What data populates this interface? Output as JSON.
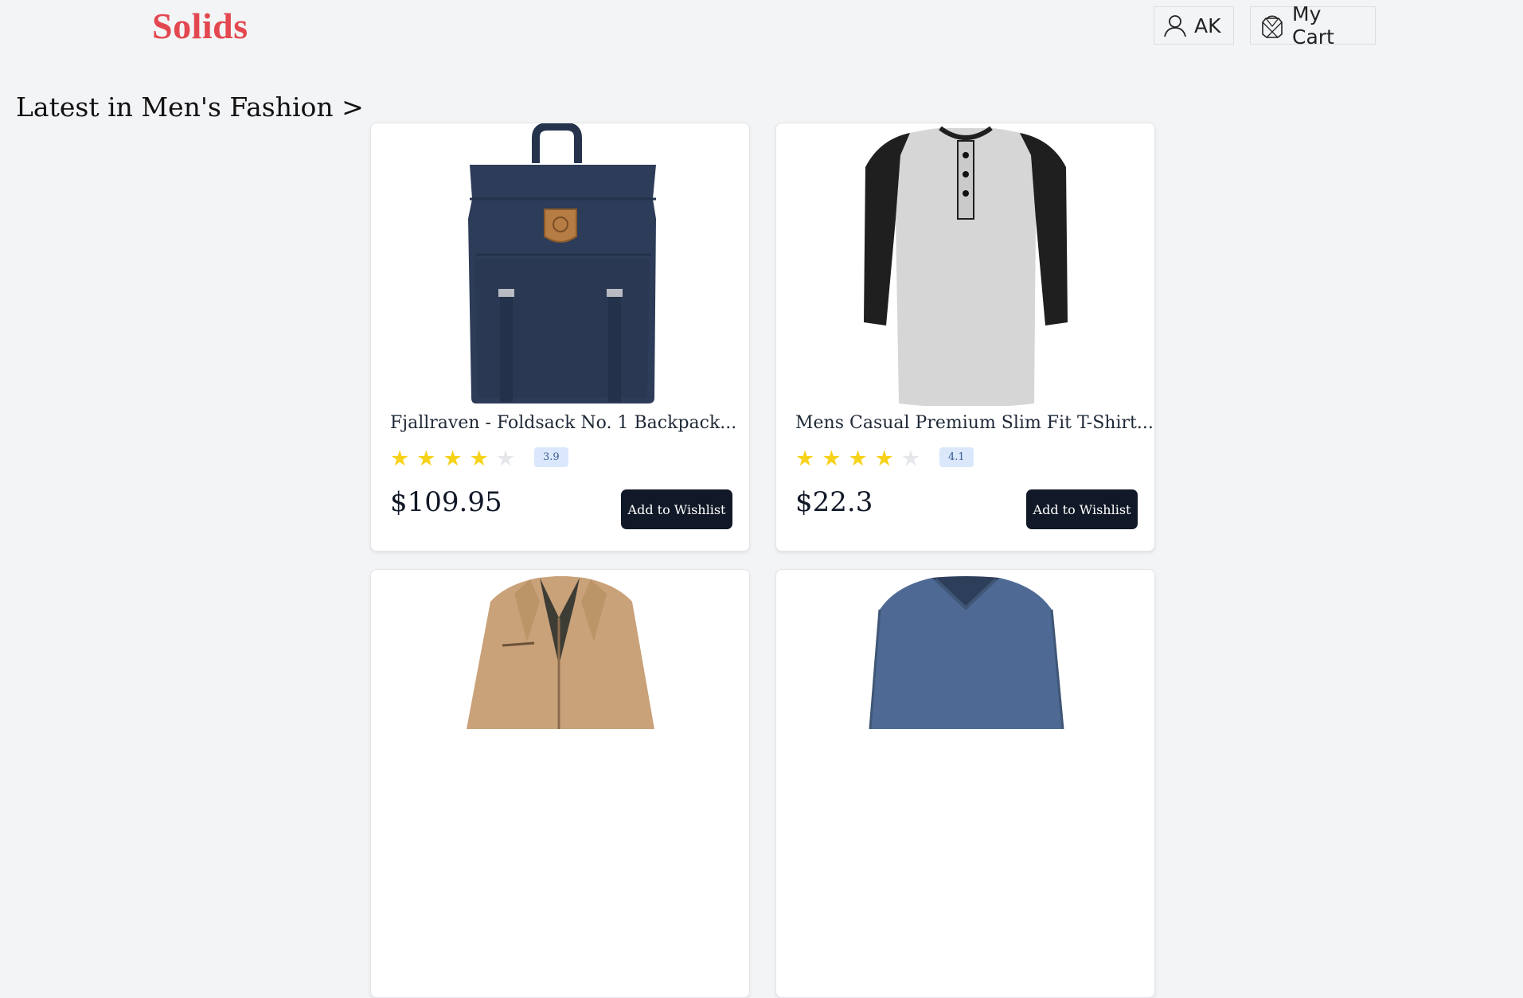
{
  "header": {
    "brand": "Solids",
    "user_label": "AK",
    "cart_label": "My Cart"
  },
  "section": {
    "title": "Latest in Men's Fashion >"
  },
  "colors": {
    "brand": "#e34850",
    "button": "#111827",
    "star": "#f6d21b",
    "badge_bg": "#dbe8fb"
  },
  "products": [
    {
      "name": "Fjallraven - Foldsack No. 1 Backpack...",
      "rating": "3.9",
      "stars_filled": 4,
      "price": "$109.95",
      "wishlist_label": "Add to Wishlist",
      "image_icon": "backpack-image"
    },
    {
      "name": "Mens Casual Premium Slim Fit T-Shirt...",
      "rating": "4.1",
      "stars_filled": 4,
      "price": "$22.3",
      "wishlist_label": "Add to Wishlist",
      "image_icon": "henley-shirt-image"
    },
    {
      "image_icon": "jacket-image"
    },
    {
      "image_icon": "vneck-shirt-image"
    }
  ]
}
